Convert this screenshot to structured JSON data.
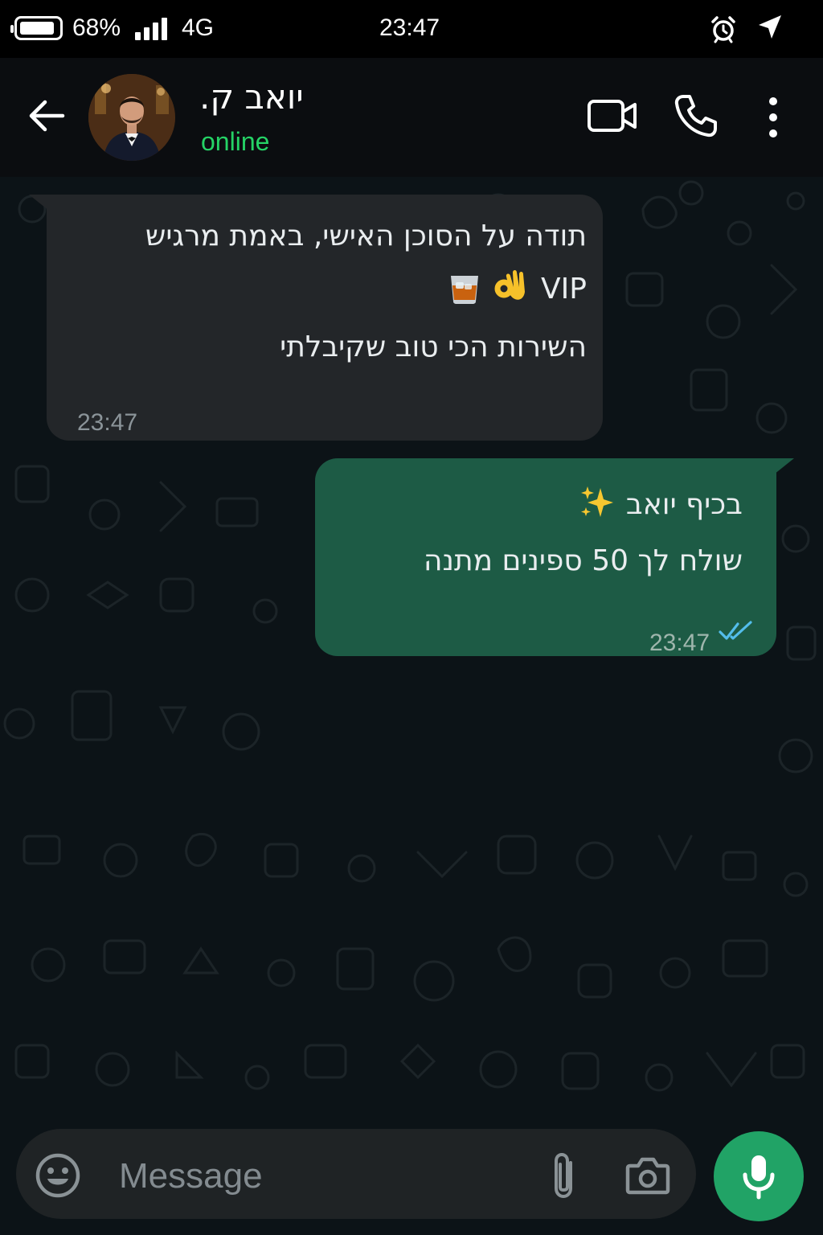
{
  "status_bar": {
    "battery": "68%",
    "network": "4G",
    "time": "23:47",
    "icons": [
      "battery-icon",
      "signal-icon",
      "alarm-icon",
      "location-arrow-icon"
    ]
  },
  "header": {
    "contact_name": "יואב ק.",
    "status": "online",
    "icons": [
      "back-arrow-icon",
      "avatar",
      "video-call-icon",
      "phone-call-icon",
      "more-options-icon"
    ]
  },
  "messages": [
    {
      "direction": "incoming",
      "lines": [
        "תודה על הסוכן האישי, באמת מרגיש",
        "VIP",
        "השירות הכי טוב שקיבלתי"
      ],
      "emojis": [
        "ok-hand-emoji",
        "whisky-glass-emoji"
      ],
      "time": "23:47"
    },
    {
      "direction": "outgoing",
      "lines": [
        "בכיף יואב",
        "שולח לך 50 ספינים מתנה"
      ],
      "emojis": [
        "sparkles-emoji"
      ],
      "time": "23:47",
      "read_status": "read-double-tick"
    }
  ],
  "input": {
    "placeholder": "Message",
    "icons": [
      "emoji-icon",
      "attach-icon",
      "camera-icon",
      "mic-icon"
    ]
  },
  "colors": {
    "status_online": "#25d366",
    "incoming_bubble": "#232629",
    "outgoing_bubble": "#1d5b45",
    "read_ticks": "#53bdeb",
    "mic_button": "#21a366",
    "chat_background": "#0c1317"
  }
}
